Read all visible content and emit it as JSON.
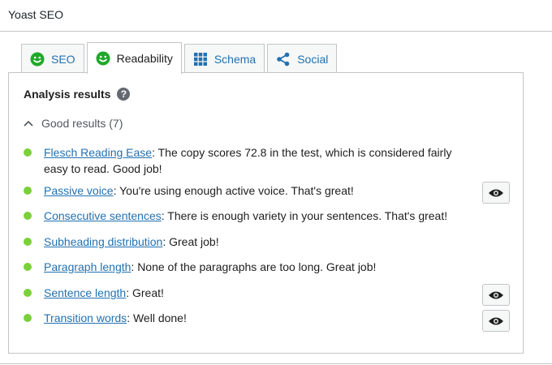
{
  "panel": {
    "title": "Yoast SEO"
  },
  "tabs": [
    {
      "label": "SEO",
      "icon": "smiley-icon"
    },
    {
      "label": "Readability",
      "icon": "smiley-icon"
    },
    {
      "label": "Schema",
      "icon": "grid-icon"
    },
    {
      "label": "Social",
      "icon": "share-icon"
    }
  ],
  "active_tab": "Readability",
  "analysis": {
    "heading": "Analysis results",
    "results_toggle": "Good results (7)",
    "results": [
      {
        "link": "Flesch Reading Ease",
        "text": ": The copy scores 72.8 in the test, which is considered fairly easy to read. Good job!",
        "has_eye": false
      },
      {
        "link": "Passive voice",
        "text": ": You're using enough active voice. That's great!",
        "has_eye": true
      },
      {
        "link": "Consecutive sentences",
        "text": ": There is enough variety in your sentences. That's great!",
        "has_eye": false
      },
      {
        "link": "Subheading distribution",
        "text": ": Great job!",
        "has_eye": false
      },
      {
        "link": "Paragraph length",
        "text": ": None of the paragraphs are too long. Great job!",
        "has_eye": false
      },
      {
        "link": "Sentence length",
        "text": ": Great!",
        "has_eye": true
      },
      {
        "link": "Transition words",
        "text": ": Well done!",
        "has_eye": true
      }
    ]
  },
  "colors": {
    "good": "#7ad03a",
    "link": "#2271b1",
    "smiley": "#20a82a",
    "accent": "#2271b1"
  }
}
